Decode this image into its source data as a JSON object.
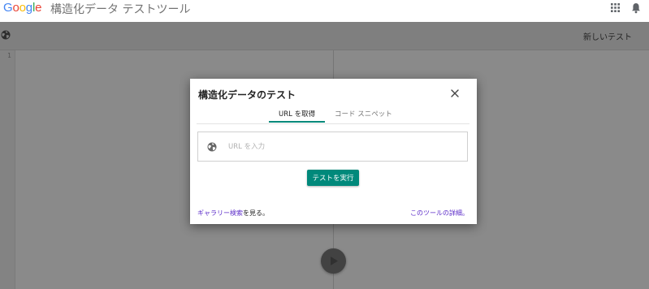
{
  "header": {
    "brand_letters": [
      {
        "ch": "G",
        "color": "#4285F4"
      },
      {
        "ch": "o",
        "color": "#EA4335"
      },
      {
        "ch": "o",
        "color": "#FBBC05"
      },
      {
        "ch": "g",
        "color": "#4285F4"
      },
      {
        "ch": "l",
        "color": "#34A853"
      },
      {
        "ch": "e",
        "color": "#EA4335"
      }
    ],
    "tool_title": "構造化データ テストツール",
    "apps_icon": "apps-grid-icon",
    "notification_icon": "bell-icon"
  },
  "toolbar": {
    "globe_icon": "globe-icon",
    "new_test_label": "新しいテスト"
  },
  "editor": {
    "line_number": "1",
    "run_icon": "play-icon"
  },
  "dialog": {
    "title": "構造化データのテスト",
    "tabs": [
      {
        "label": "URL を取得",
        "active": true
      },
      {
        "label": "コード スニペット",
        "active": false
      }
    ],
    "url_placeholder": "URL を入力",
    "url_value": "",
    "run_button_label": "テストを実行",
    "gallery_link": "ギャラリー検索",
    "gallery_suffix": "を見る。",
    "details_link": "このツールの詳細。"
  },
  "colors": {
    "accent": "#00897b",
    "link": "#5b2bc8"
  }
}
